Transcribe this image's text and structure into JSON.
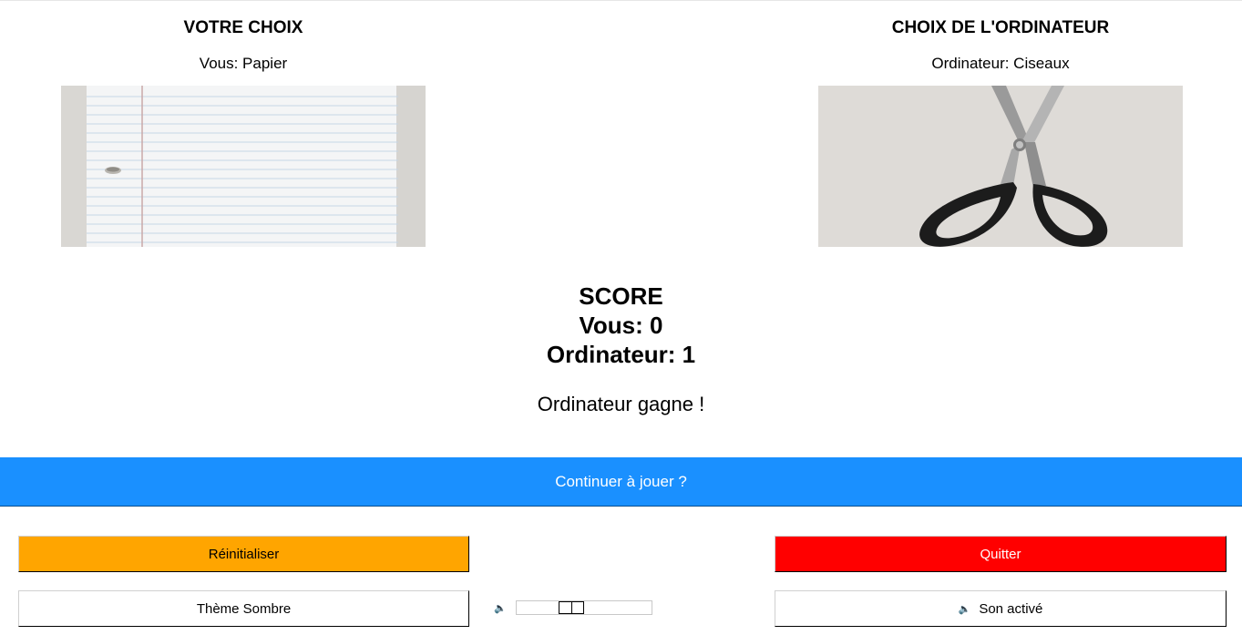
{
  "player": {
    "title": "VOTRE CHOIX",
    "choice_text": "Vous: Papier",
    "image": "paper-sheet"
  },
  "computer": {
    "title": "CHOIX DE L'ORDINATEUR",
    "choice_text": "Ordinateur: Ciseaux",
    "image": "scissors"
  },
  "score": {
    "title": "SCORE",
    "player_line": "Vous: 0",
    "computer_line": "Ordinateur: 1",
    "player_score": 0,
    "computer_score": 1
  },
  "result_text": "Ordinateur gagne !",
  "continue_label": "Continuer à jouer ?",
  "buttons": {
    "reset_label": "Réinitialiser",
    "quit_label": "Quitter",
    "theme_label": "Thème Sombre",
    "sound_label": "Son activé",
    "sound_icon": "speaker-icon"
  },
  "volume": {
    "icon": "speaker-icon",
    "value_fraction": 0.38
  },
  "colors": {
    "continue_bg": "#1a90ff",
    "reset_bg": "#ffa500",
    "quit_bg": "#ff0000"
  }
}
